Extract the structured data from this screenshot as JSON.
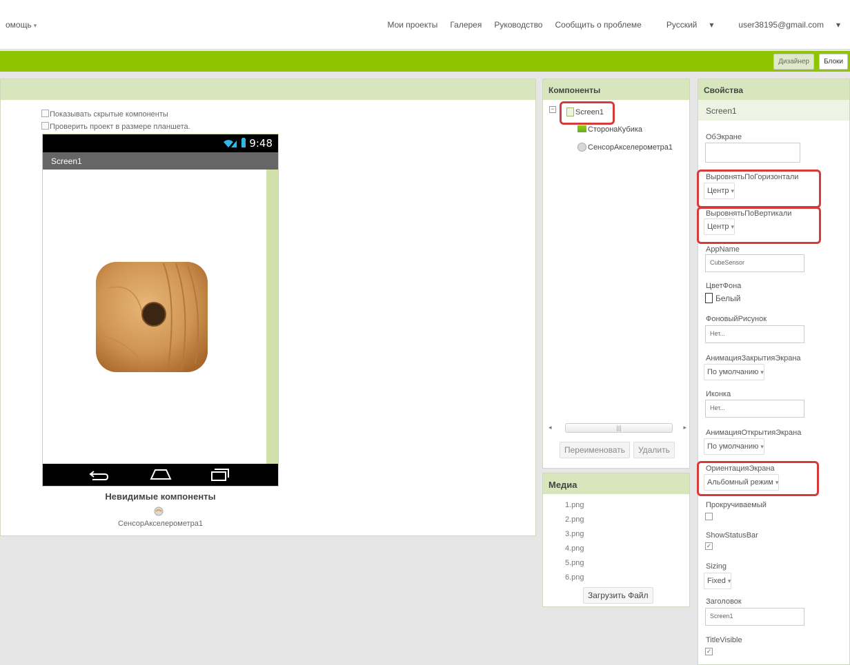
{
  "topnav": {
    "help": "омощь",
    "links": [
      "Мои проекты",
      "Галерея",
      "Руководство",
      "Сообщить о проблеме"
    ],
    "language": "Русский",
    "account": "user38195@gmail.com"
  },
  "toolbar": {
    "designer_label": "Дизайнер",
    "blocks_label": "Блоки"
  },
  "viewer": {
    "show_hidden": "Показывать скрытые компоненты",
    "tablet_size": "Проверить проект в размере планшета.",
    "clock": "9:48",
    "screen_title": "Screen1",
    "invisible_title": "Невидимые компоненты",
    "invisible_item": "СенсорАкселерометра1"
  },
  "components": {
    "title": "Компоненты",
    "root": "Screen1",
    "children": [
      "СторонаКубика",
      "СенсорАкселерометра1"
    ],
    "rename_label": "Переименовать",
    "delete_label": "Удалить"
  },
  "media": {
    "title": "Медиа",
    "files": [
      "1.png",
      "2.png",
      "3.png",
      "4.png",
      "5.png",
      "6.png"
    ],
    "upload_label": "Загрузить Файл"
  },
  "properties": {
    "title": "Свойства",
    "component": "Screen1",
    "about_label": "ОбЭкране",
    "about_value": "",
    "align_h_label": "ВыровнятьПоГоризонтали",
    "align_h_value": "Центр",
    "align_v_label": "ВыровнятьПоВертикали",
    "align_v_value": "Центр",
    "appname_label": "AppName",
    "appname_value": "CubeSensor",
    "bgcolor_label": "ЦветФона",
    "bgcolor_value": "Белый",
    "bgimage_label": "ФоновыйРисунок",
    "bgimage_value": "Нет...",
    "close_anim_label": "АнимацияЗакрытияЭкрана",
    "close_anim_value": "По умолчанию",
    "icon_label": "Иконка",
    "icon_value": "Нет...",
    "open_anim_label": "АнимацияОткрытияЭкрана",
    "open_anim_value": "По умолчанию",
    "orientation_label": "ОриентацияЭкрана",
    "orientation_value": "Альбомный режим",
    "scrollable_label": "Прокручиваемый",
    "statusbar_label": "ShowStatusBar",
    "sizing_label": "Sizing",
    "sizing_value": "Fixed",
    "title_label": "Заголовок",
    "title_value": "Screen1",
    "titlevisible_label": "TitleVisible"
  },
  "colors": {
    "accent_green": "#8fc400",
    "panel_header": "#d8e6bd",
    "highlight_red": "#d63b3b"
  }
}
